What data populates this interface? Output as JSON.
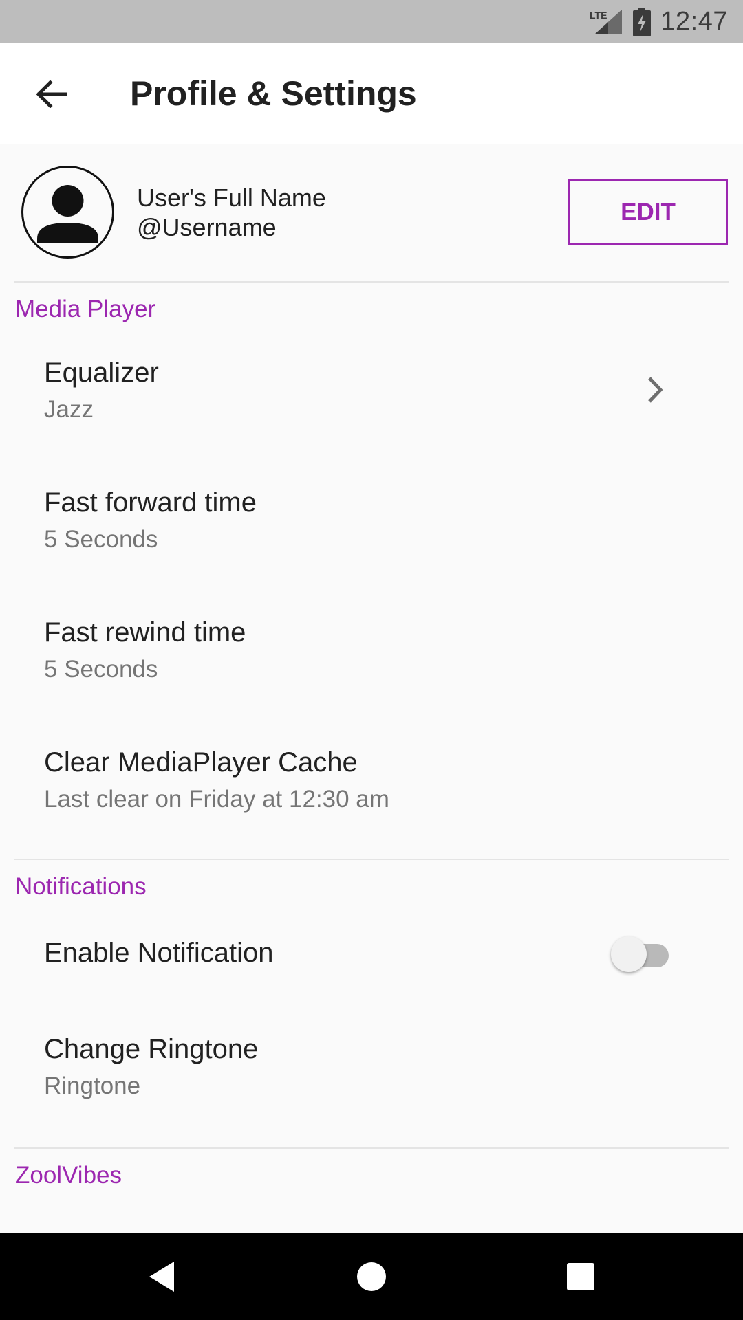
{
  "status_bar": {
    "network": "LTE",
    "time": "12:47",
    "icons": [
      "lte-signal-icon",
      "battery-charging-icon"
    ]
  },
  "app_bar": {
    "back_icon": "arrow-back-icon",
    "title": "Profile & Settings"
  },
  "profile": {
    "avatar_icon": "person-icon",
    "full_name": "User's Full Name",
    "username": "@Username",
    "edit_label": "EDIT"
  },
  "sections": {
    "media_player": {
      "header": "Media Player",
      "items": [
        {
          "title": "Equalizer",
          "subtitle": "Jazz",
          "icon": "chevron-right-icon"
        },
        {
          "title": "Fast forward time",
          "subtitle": "5 Seconds"
        },
        {
          "title": "Fast rewind time",
          "subtitle": "5 Seconds"
        },
        {
          "title": "Clear MediaPlayer Cache",
          "subtitle": "Last clear on Friday at 12:30 am"
        }
      ]
    },
    "notifications": {
      "header": "Notifications",
      "enable_notification": {
        "title": "Enable Notification",
        "enabled": false
      },
      "change_ringtone": {
        "title": "Change Ringtone",
        "subtitle": "Ringtone"
      }
    },
    "zoolvibes": {
      "header": "ZoolVibes"
    }
  },
  "nav_bar": {
    "icons": [
      "nav-back-icon",
      "nav-home-icon",
      "nav-recents-icon"
    ]
  },
  "colors": {
    "accent": "#9c27b0",
    "status_bar": "#bdbdbd",
    "background": "#fafafa",
    "secondary_text": "#757575"
  }
}
